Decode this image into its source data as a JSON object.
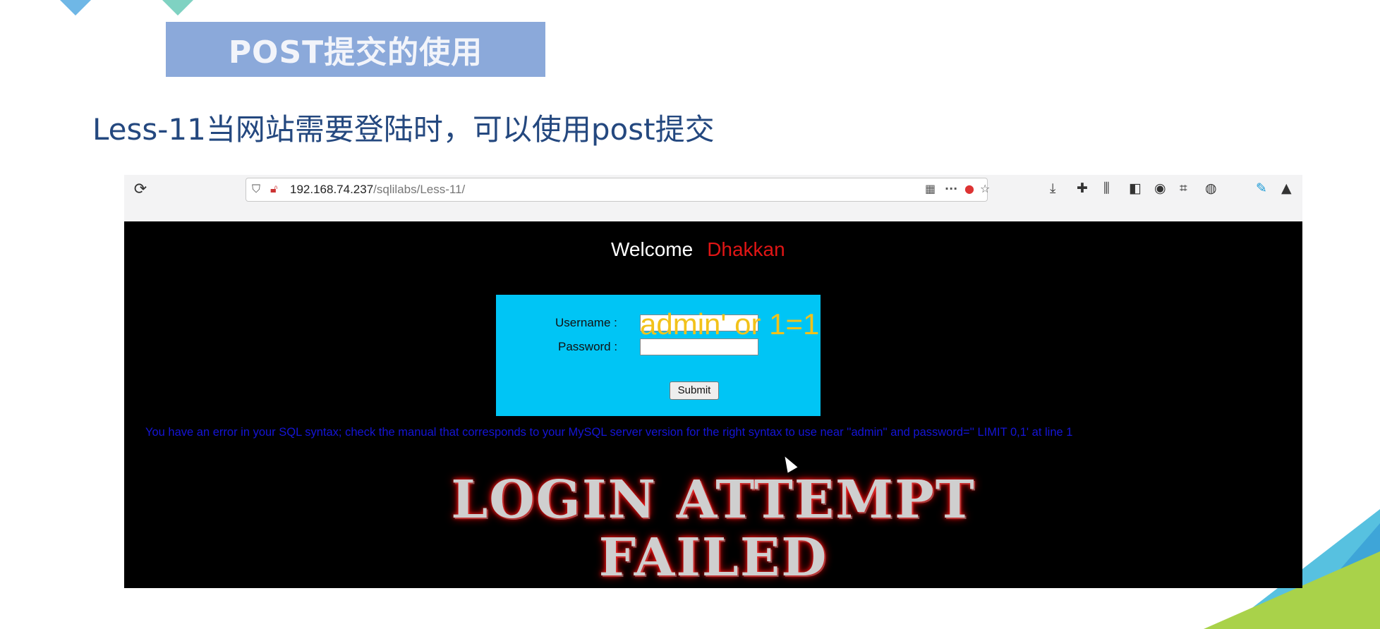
{
  "slide": {
    "title": "POST提交的使用",
    "subtitle": "Less-11当网站需要登陆时，可以使用post提交"
  },
  "browser": {
    "url_host": "192.168.74.237",
    "url_path": "/sqlilabs/Less-11/",
    "icons": [
      "reload-icon",
      "shield-icon",
      "insecure-lock-icon",
      "qr-icon",
      "more-icon",
      "ublock-icon",
      "star-icon",
      "download-icon",
      "extensions-icon",
      "library-icon",
      "sidebar-icon",
      "account-icon",
      "crop-icon",
      "chat-icon",
      "edit-icon",
      "up-icon"
    ]
  },
  "page": {
    "welcome": "Welcome",
    "user_name": "Dhakkan",
    "username_label": "Username :",
    "password_label": "Password :",
    "injected_text": "admin' or 1=1",
    "submit_label": "Submit",
    "sql_error": "You have an error in your SQL syntax; check the manual that corresponds to your MySQL server version for the right syntax to use near ''admin'' and password='' LIMIT 0,1' at line 1",
    "failed_line1": "LOGIN ATTEMPT",
    "failed_line2": "FAILED"
  },
  "colors": {
    "title_box": "#8ba9da",
    "subtitle": "#24487f",
    "login_box": "#00c5f5",
    "user_name": "#e01515",
    "injected_text": "#f2c21a",
    "sql_error": "#1515d6"
  }
}
